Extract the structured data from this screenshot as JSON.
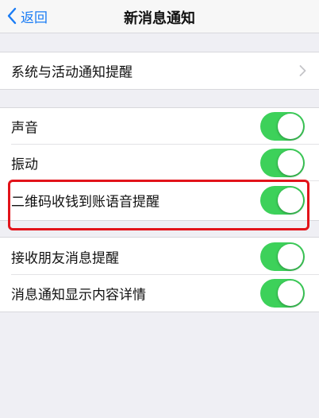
{
  "navbar": {
    "back_label": "返回",
    "title": "新消息通知"
  },
  "group1": {
    "items": [
      {
        "label": "系统与活动通知提醒",
        "type": "link"
      }
    ]
  },
  "group2": {
    "items": [
      {
        "label": "声音",
        "type": "toggle",
        "on": true
      },
      {
        "label": "振动",
        "type": "toggle",
        "on": true
      },
      {
        "label": "二维码收钱到账语音提醒",
        "type": "toggle",
        "on": true
      },
      {
        "label": "接收朋友消息提醒",
        "type": "toggle",
        "on": true
      },
      {
        "label": "消息通知显示内容详情",
        "type": "toggle",
        "on": true
      }
    ]
  },
  "colors": {
    "accent": "#1a7cf5",
    "toggle_on": "#3dd15a",
    "highlight": "#e2131a",
    "background": "#efeff4"
  },
  "icons": {
    "back": "chevron-left-icon",
    "disclosure": "chevron-right-icon"
  }
}
